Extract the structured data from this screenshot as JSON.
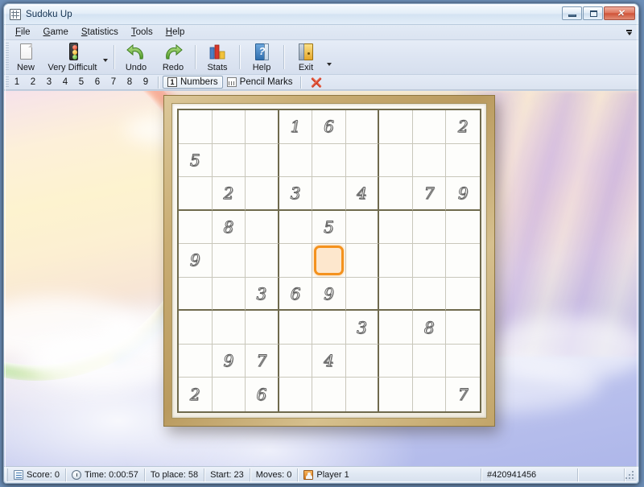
{
  "window": {
    "title": "Sudoku Up",
    "title_icon": "sudoku-grid-icon",
    "minimize_label": "–",
    "maximize_label": "□",
    "close_label": "✕"
  },
  "menubar": {
    "items": [
      {
        "label": "File",
        "mnemonic": "F"
      },
      {
        "label": "Game",
        "mnemonic": "G"
      },
      {
        "label": "Statistics",
        "mnemonic": "S"
      },
      {
        "label": "Tools",
        "mnemonic": "T"
      },
      {
        "label": "Help",
        "mnemonic": "H"
      }
    ],
    "overflow_icon": "menu-overflow-chevron-icon"
  },
  "toolbar": {
    "buttons": [
      {
        "label": "New",
        "icon": "new-page-icon"
      },
      {
        "label": "Very Difficult",
        "icon": "traffic-light-icon",
        "has_dropdown": true
      },
      {
        "label": "Undo",
        "icon": "undo-arrow-icon"
      },
      {
        "label": "Redo",
        "icon": "redo-arrow-icon"
      },
      {
        "label": "Stats",
        "icon": "bar-chart-icon"
      },
      {
        "label": "Help",
        "icon": "help-book-icon"
      },
      {
        "label": "Exit",
        "icon": "exit-door-icon"
      }
    ],
    "overflow_icon": "toolbar-overflow-chevron-icon"
  },
  "numberbar": {
    "numbers": [
      "1",
      "2",
      "3",
      "4",
      "5",
      "6",
      "7",
      "8",
      "9"
    ],
    "modes": [
      {
        "label": "Numbers",
        "icon": "number-mode-icon",
        "active": true
      },
      {
        "label": "Pencil Marks",
        "icon": "pencil-marks-icon",
        "active": false
      }
    ],
    "clear_icon": "red-x-clear-icon"
  },
  "board": {
    "selected_cell": {
      "row": 5,
      "col": 5
    },
    "grid": [
      [
        "",
        "",
        "",
        "1",
        "6",
        "",
        "",
        "",
        "2"
      ],
      [
        "5",
        "",
        "",
        "",
        "",
        "",
        "",
        "",
        ""
      ],
      [
        "",
        "2",
        "",
        "3",
        "",
        "4",
        "",
        "7",
        "9"
      ],
      [
        "",
        "8",
        "",
        "",
        "5",
        "",
        "",
        "",
        ""
      ],
      [
        "9",
        "",
        "",
        "",
        "",
        "",
        "",
        "",
        ""
      ],
      [
        "",
        "",
        "3",
        "6",
        "9",
        "",
        "",
        "",
        ""
      ],
      [
        "",
        "",
        "",
        "",
        "",
        "3",
        "",
        "8",
        ""
      ],
      [
        "",
        "9",
        "7",
        "",
        "4",
        "",
        "",
        "",
        ""
      ],
      [
        "2",
        "",
        "6",
        "",
        "",
        "",
        "",
        "",
        "7"
      ]
    ]
  },
  "statusbar": {
    "score": "Score: 0",
    "time": "Time: 0:00:57",
    "to_place": "To place: 58",
    "start": "Start: 23",
    "moves": "Moves: 0",
    "player": "Player 1",
    "puzzle_id": "#420941456",
    "score_icon": "score-sheet-icon",
    "clock_icon": "stopwatch-icon",
    "player_icon": "players-icon",
    "grip_icon": "resize-grip-icon"
  },
  "colors": {
    "selection_border": "#f4921e",
    "selection_fill": "#fde7cd",
    "frame_gold": "#c2a569",
    "grid_block_line": "#6f6a4d",
    "grid_cell_line": "#c9c7bb"
  }
}
